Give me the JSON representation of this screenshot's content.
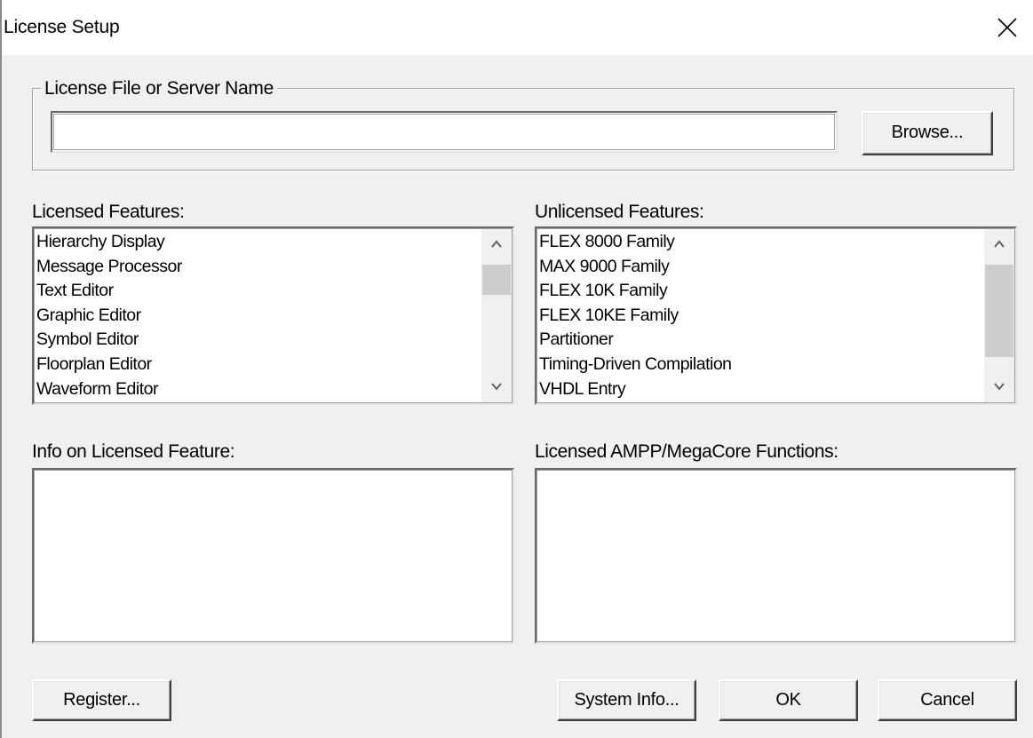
{
  "window": {
    "title": "License Setup"
  },
  "license_group": {
    "legend": "License File or Server Name",
    "input_value": "",
    "browse_label": "Browse..."
  },
  "licensed_features": {
    "label": "Licensed Features:",
    "items": [
      "Hierarchy Display",
      "Message Processor",
      "Text Editor",
      "Graphic Editor",
      "Symbol Editor",
      "Floorplan Editor",
      "Waveform Editor"
    ]
  },
  "unlicensed_features": {
    "label": "Unlicensed Features:",
    "items": [
      "FLEX 8000 Family",
      "MAX 9000 Family",
      "FLEX 10K Family",
      "FLEX 10KE Family",
      "Partitioner",
      "Timing-Driven Compilation",
      "VHDL Entry"
    ]
  },
  "info_panel": {
    "label": "Info on Licensed Feature:"
  },
  "ampp_panel": {
    "label": "Licensed AMPP/MegaCore Functions:"
  },
  "buttons": {
    "register": "Register...",
    "system_info": "System Info...",
    "ok": "OK",
    "cancel": "Cancel"
  },
  "icons": {
    "close": "close-icon",
    "scroll_up": "chevron-up-icon",
    "scroll_down": "chevron-down-icon"
  }
}
